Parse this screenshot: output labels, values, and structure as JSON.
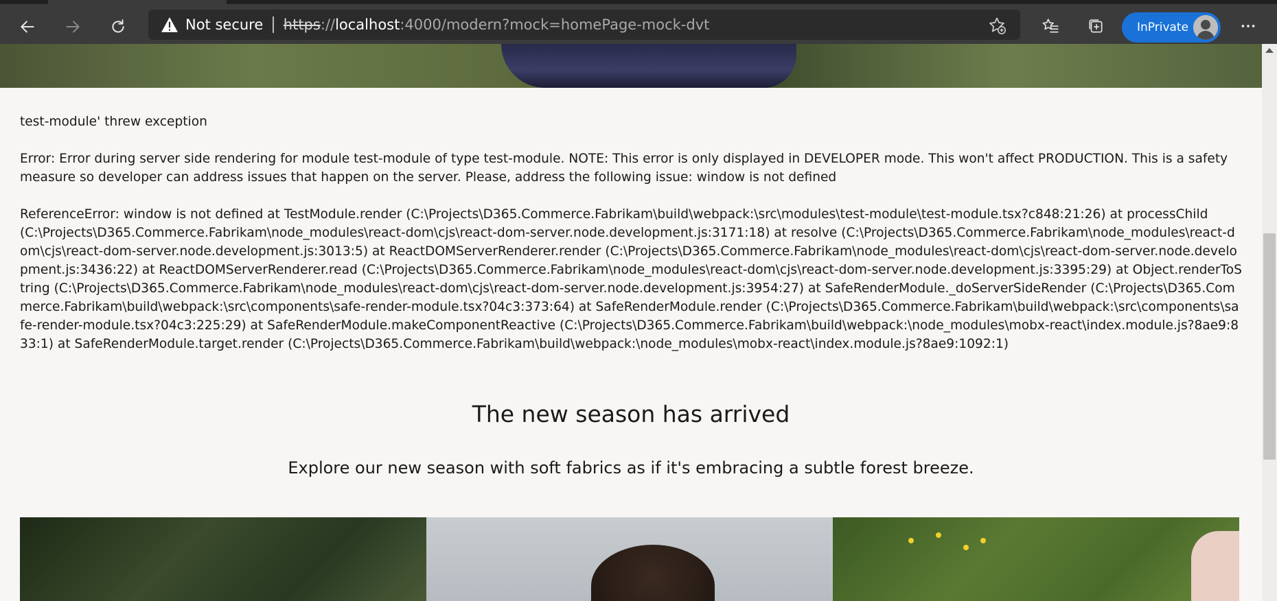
{
  "browser": {
    "security_label": "Not secure",
    "url_scheme": "https",
    "url_separator": "://",
    "url_host": "localhost",
    "url_rest": ":4000/modern?mock=homePage-mock-dvt",
    "inprivate_label": "InPrivate",
    "icons": {
      "back": "back-arrow-icon",
      "forward": "forward-arrow-icon",
      "refresh": "refresh-icon",
      "warning": "warning-icon",
      "add_favorite": "add-favorite-icon",
      "favorites": "favorites-icon",
      "collections": "collections-icon",
      "more": "more-icon"
    },
    "colors": {
      "toolbar": "#3b3b3b",
      "address_bar": "#2b2b2b",
      "inprivate": "#1a72d8"
    }
  },
  "page": {
    "error": {
      "module_line": "test-module' threw exception",
      "message": "Error: Error during server side rendering for module test-module of type test-module. NOTE: This error is only displayed in DEVELOPER mode. This won't affect PRODUCTION. This is a safety measure so developer can address issues that happen on the server. Please, address the following issue: window is not defined",
      "stack": "ReferenceError: window is not defined at TestModule.render (C:\\Projects\\D365.Commerce.Fabrikam\\build\\webpack:\\src\\modules\\test-module\\test-module.tsx?c848:21:26) at processChild (C:\\Projects\\D365.Commerce.Fabrikam\\node_modules\\react-dom\\cjs\\react-dom-server.node.development.js:3171:18) at resolve (C:\\Projects\\D365.Commerce.Fabrikam\\node_modules\\react-dom\\cjs\\react-dom-server.node.development.js:3013:5) at ReactDOMServerRenderer.render (C:\\Projects\\D365.Commerce.Fabrikam\\node_modules\\react-dom\\cjs\\react-dom-server.node.development.js:3436:22) at ReactDOMServerRenderer.read (C:\\Projects\\D365.Commerce.Fabrikam\\node_modules\\react-dom\\cjs\\react-dom-server.node.development.js:3395:29) at Object.renderToString (C:\\Projects\\D365.Commerce.Fabrikam\\node_modules\\react-dom\\cjs\\react-dom-server.node.development.js:3954:27) at SafeRenderModule._doServerSideRender (C:\\Projects\\D365.Commerce.Fabrikam\\build\\webpack:\\src\\components\\safe-render-module.tsx?04c3:373:64) at SafeRenderModule.render (C:\\Projects\\D365.Commerce.Fabrikam\\build\\webpack:\\src\\components\\safe-render-module.tsx?04c3:225:29) at SafeRenderModule.makeComponentReactive (C:\\Projects\\D365.Commerce.Fabrikam\\build\\webpack:\\node_modules\\mobx-react\\index.module.js?8ae9:833:1) at SafeRenderModule.target.render (C:\\Projects\\D365.Commerce.Fabrikam\\build\\webpack:\\node_modules\\mobx-react\\index.module.js?8ae9:1092:1)"
    },
    "promo": {
      "title": "The new season has arrived",
      "subtitle": "Explore our new season with soft fabrics as if it's embracing a subtle forest breeze."
    }
  }
}
